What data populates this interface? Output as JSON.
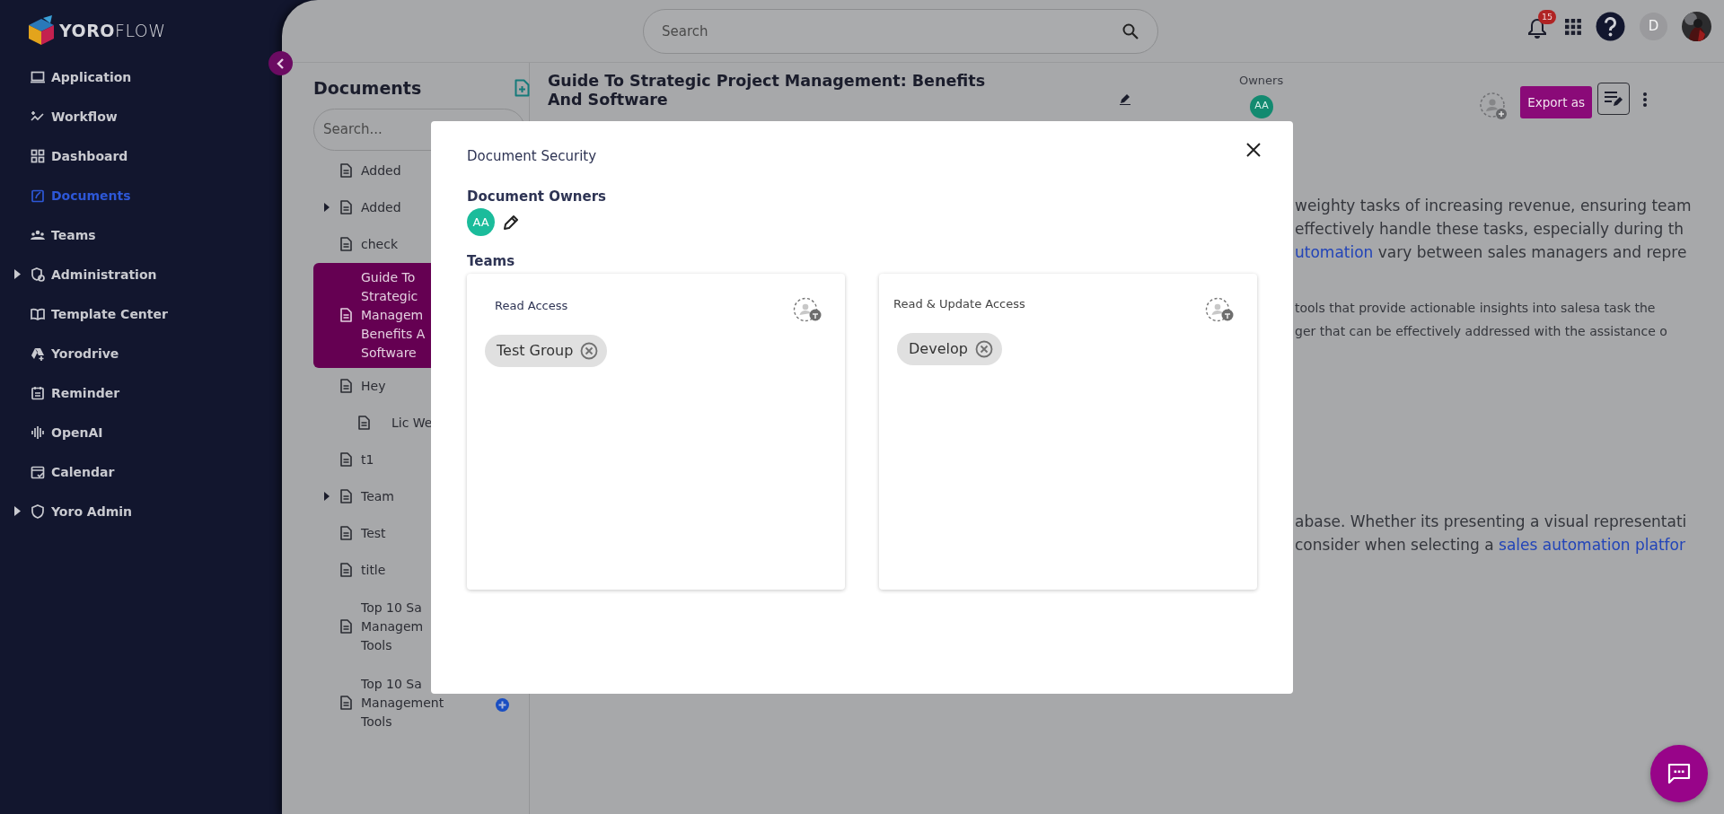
{
  "logo": "**YORO**FLOW",
  "sidebar": {
    "items": [
      {
        "label": "Application",
        "selected": false,
        "expandable": false
      },
      {
        "label": "Workflow",
        "selected": false,
        "expandable": false
      },
      {
        "label": "Dashboard",
        "selected": false,
        "expandable": false
      },
      {
        "label": "Documents",
        "selected": true,
        "expandable": false
      },
      {
        "label": "Teams",
        "selected": false,
        "expandable": false
      },
      {
        "label": "Administration",
        "selected": false,
        "expandable": true
      },
      {
        "label": "Template Center",
        "selected": false,
        "expandable": false
      },
      {
        "label": "Yorodrive",
        "selected": false,
        "expandable": false
      },
      {
        "label": "Reminder",
        "selected": false,
        "expandable": false
      },
      {
        "label": "OpenAI",
        "selected": false,
        "expandable": false
      },
      {
        "label": "Calendar",
        "selected": false,
        "expandable": false
      },
      {
        "label": "Yoro Admin",
        "selected": false,
        "expandable": true
      }
    ]
  },
  "topbar": {
    "search": {
      "placeholder": "Search"
    },
    "notifications": "15",
    "user_initial": "D"
  },
  "documents_panel": {
    "title": "Documents",
    "search": {
      "placeholder": "Search..."
    },
    "items": [
      {
        "lines": [
          "Added"
        ],
        "selected": false,
        "expandable": false
      },
      {
        "lines": [
          "Added"
        ],
        "selected": false,
        "expandable": true
      },
      {
        "lines": [
          "check"
        ],
        "selected": false,
        "expandable": false
      },
      {
        "lines": [
          "Guide To",
          "Strategic",
          "Managem",
          "Benefits A",
          "Software"
        ],
        "selected": true,
        "expandable": false
      },
      {
        "lines": [
          "Hey"
        ],
        "selected": false,
        "expandable": false,
        "children": [
          {
            "lines": [
              "Lic We"
            ],
            "selected": false,
            "expandable": false
          }
        ]
      },
      {
        "lines": [
          "t1"
        ],
        "selected": false,
        "expandable": false
      },
      {
        "lines": [
          "Team"
        ],
        "selected": false,
        "expandable": true
      },
      {
        "lines": [
          "Test"
        ],
        "selected": false,
        "expandable": false
      },
      {
        "lines": [
          "title"
        ],
        "selected": false,
        "expandable": false
      },
      {
        "lines": [
          "Top 10 Sa",
          "Managem",
          "Tools"
        ],
        "selected": false,
        "expandable": false
      },
      {
        "lines": [
          "Top 10 Sa",
          "Management",
          "Tools"
        ],
        "selected": false,
        "expandable": false,
        "add_button": true
      }
    ]
  },
  "document": {
    "title": "Guide To Strategic Project Management: Benefits And Software",
    "owners_label": "Owners",
    "owners": [
      "AA"
    ],
    "export_button": "Export as",
    "paragraphs": [
      {
        "kind": "large",
        "lines": [
          [
            {
              "text": "weighty tasks of increasing revenue, ensuring team"
            }
          ],
          [
            {
              "text": "effectively handle these tasks, especially during th"
            }
          ],
          [
            {
              "kind": "link",
              "text": "utomation"
            },
            {
              "text": " vary between sales managers and repre"
            }
          ]
        ]
      },
      {
        "kind": "small",
        "lines": [
          [
            {
              "text": "tools that provide actionable insights into salesa task the"
            }
          ],
          [
            {
              "text": "ger that can be effectively addressed with the assistance o"
            }
          ]
        ]
      },
      {
        "kind": "large",
        "lines": [
          [
            {
              "text": "abase. Whether its presenting a visual representati"
            }
          ],
          [
            {
              "text": "consider when selecting a "
            },
            {
              "kind": "link",
              "text": "sales automation platfor"
            }
          ]
        ]
      }
    ]
  },
  "modal": {
    "title": "Document Security",
    "owners_heading": "Document Owners",
    "owners": [
      "AA"
    ],
    "teams_heading": "Teams",
    "groups": [
      {
        "title": "Read Access",
        "teams": [
          "Test Group"
        ]
      },
      {
        "title": "Read & Update Access",
        "teams": [
          "Develop"
        ]
      }
    ]
  }
}
